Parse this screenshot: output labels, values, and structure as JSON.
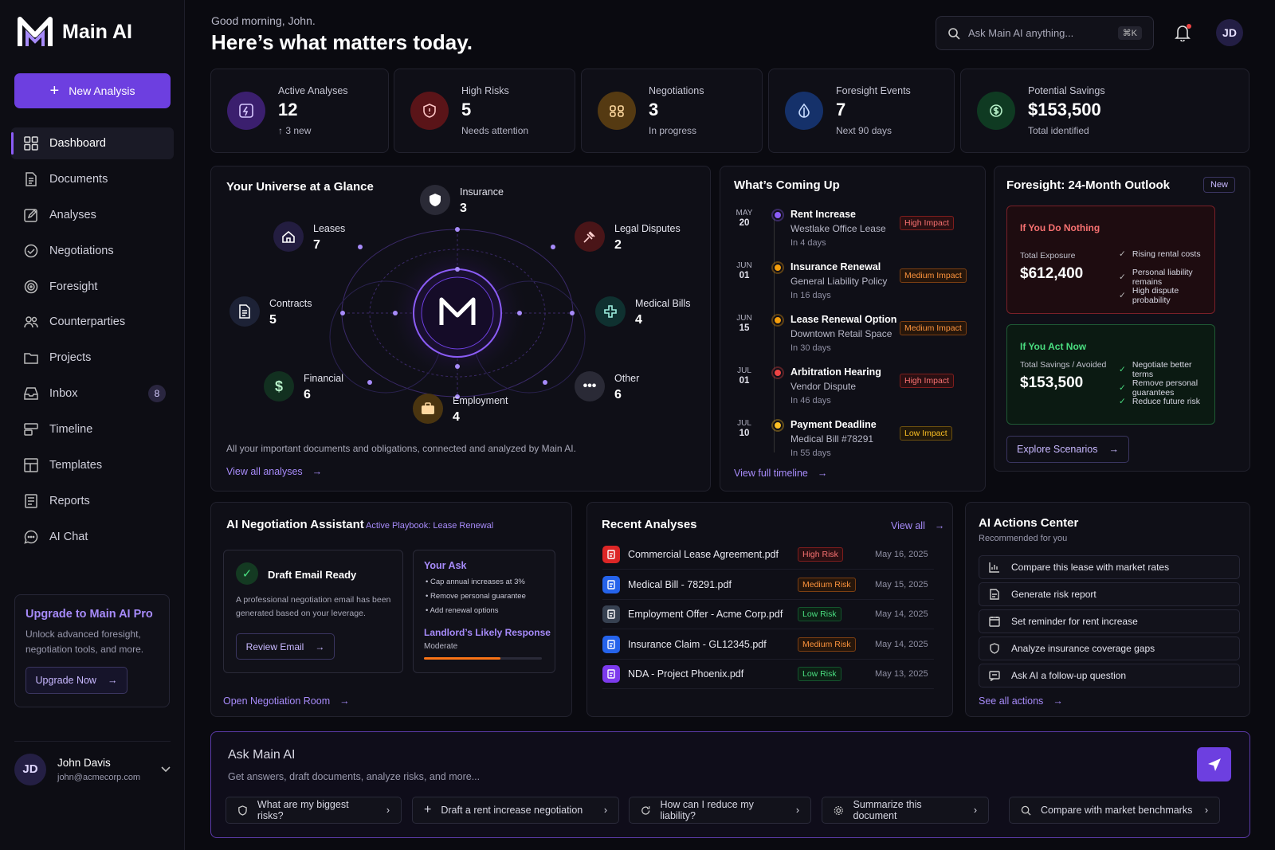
{
  "brand": {
    "name": "Main AI"
  },
  "sidebar": {
    "new_analysis": "New Analysis",
    "items": [
      {
        "label": "Dashboard",
        "icon": "grid-icon"
      },
      {
        "label": "Documents",
        "icon": "document-icon"
      },
      {
        "label": "Analyses",
        "icon": "edit-icon"
      },
      {
        "label": "Negotiations",
        "icon": "handshake-icon"
      },
      {
        "label": "Foresight",
        "icon": "target-icon"
      },
      {
        "label": "Counterparties",
        "icon": "people-icon"
      },
      {
        "label": "Projects",
        "icon": "folder-icon"
      },
      {
        "label": "Inbox",
        "icon": "inbox-icon",
        "badge": "8"
      },
      {
        "label": "Timeline",
        "icon": "timeline-icon"
      },
      {
        "label": "Templates",
        "icon": "templates-icon"
      },
      {
        "label": "Reports",
        "icon": "report-icon"
      },
      {
        "label": "AI Chat",
        "icon": "chat-icon"
      }
    ],
    "upgrade": {
      "title": "Upgrade to Main AI Pro",
      "desc": "Unlock advanced foresight, negotiation tools, and more.",
      "button": "Upgrade Now"
    },
    "user": {
      "initials": "JD",
      "name": "John Davis",
      "email": "john@acmecorp.com"
    }
  },
  "header": {
    "greeting": "Good morning, John.",
    "headline": "Here’s what matters today.",
    "search_placeholder": "Ask Main AI anything...",
    "shortcut": "⌘K",
    "avatar": "JD"
  },
  "kpis": [
    {
      "label": "Active Analyses",
      "value": "12",
      "sub": "↑ 3 new",
      "color": "#8b5cf6"
    },
    {
      "label": "High Risks",
      "value": "5",
      "sub": "Needs attention",
      "color": "#ef4444"
    },
    {
      "label": "Negotiations",
      "value": "3",
      "sub": "In progress",
      "color": "#f59e0b"
    },
    {
      "label": "Foresight Events",
      "value": "7",
      "sub": "Next 90 days",
      "color": "#3b82f6"
    },
    {
      "label": "Potential Savings",
      "value": "$153,500",
      "sub": "Total identified",
      "color": "#22c55e"
    }
  ],
  "universe": {
    "title": "Your Universe at a Glance",
    "nodes": {
      "insurance": {
        "name": "Insurance",
        "count": "3"
      },
      "leases": {
        "name": "Leases",
        "count": "7"
      },
      "legal": {
        "name": "Legal Disputes",
        "count": "2"
      },
      "contracts": {
        "name": "Contracts",
        "count": "5"
      },
      "medical": {
        "name": "Medical Bills",
        "count": "4"
      },
      "financial": {
        "name": "Financial",
        "count": "6"
      },
      "other": {
        "name": "Other",
        "count": "6"
      },
      "employment": {
        "name": "Employment",
        "count": "4"
      }
    },
    "caption": "All your important documents and obligations, connected and analyzed by Main AI.",
    "link": "View all analyses"
  },
  "coming": {
    "title": "What’s Coming Up",
    "items": [
      {
        "mon": "MAY",
        "day": "20",
        "title": "Rent Increase",
        "sub": "Westlake Office Lease",
        "when": "In 4 days",
        "impact": "High Impact",
        "level": "hi",
        "dot": "#8b5cf6"
      },
      {
        "mon": "JUN",
        "day": "01",
        "title": "Insurance Renewal",
        "sub": "General Liability Policy",
        "when": "In 16 days",
        "impact": "Medium Impact",
        "level": "med",
        "dot": "#f59e0b"
      },
      {
        "mon": "JUN",
        "day": "15",
        "title": "Lease Renewal Option",
        "sub": "Downtown Retail Space",
        "when": "In 30 days",
        "impact": "Medium Impact",
        "level": "med",
        "dot": "#f59e0b"
      },
      {
        "mon": "JUL",
        "day": "01",
        "title": "Arbitration Hearing",
        "sub": "Vendor Dispute",
        "when": "In 46 days",
        "impact": "High Impact",
        "level": "hi",
        "dot": "#ef4444"
      },
      {
        "mon": "JUL",
        "day": "10",
        "title": "Payment Deadline",
        "sub": "Medical Bill #78291",
        "when": "In 55 days",
        "impact": "Low Impact",
        "level": "lo",
        "dot": "#fbbf24"
      }
    ],
    "link": "View full timeline"
  },
  "foresight": {
    "title": "Foresight: 24-Month Outlook",
    "badge": "New",
    "nothing": {
      "head": "If You Do Nothing",
      "label": "Total Exposure",
      "value": "$612,400",
      "checks": [
        "Rising rental costs",
        "Personal liability remains",
        "High dispute probability"
      ]
    },
    "act": {
      "head": "If You Act Now",
      "label": "Total Savings / Avoided",
      "value": "$153,500",
      "checks": [
        "Negotiate better terms",
        "Remove personal guarantees",
        "Reduce future risk"
      ]
    },
    "button": "Explore Scenarios"
  },
  "negotiation": {
    "title": "AI Negotiation Assistant",
    "playbook": "Active Playbook: Lease Renewal",
    "draft": {
      "title": "Draft Email Ready",
      "desc": "A professional negotiation email has been generated based on your leverage.",
      "button": "Review Email"
    },
    "ask": {
      "title": "Your Ask",
      "bullets": [
        "Cap annual increases at 3%",
        "Remove personal guarantee",
        "Add renewal options"
      ],
      "response_title": "Landlord’s Likely Response",
      "response_value": "Moderate",
      "response_level": 0.65
    },
    "link": "Open Negotiation Room"
  },
  "recent": {
    "title": "Recent Analyses",
    "view_all": "View all",
    "rows": [
      {
        "name": "Commercial Lease Agreement.pdf",
        "risk": "High Risk",
        "level": "hi",
        "date": "May 16, 2025",
        "icon": "pdf-icon",
        "color": "#dc2626"
      },
      {
        "name": "Medical Bill - 78291.pdf",
        "risk": "Medium Risk",
        "level": "med",
        "date": "May 15, 2025",
        "icon": "medical-icon",
        "color": "#2563eb"
      },
      {
        "name": "Employment Offer - Acme Corp.pdf",
        "risk": "Low Risk",
        "level": "lor",
        "date": "May 14, 2025",
        "icon": "briefcase-icon",
        "color": "#374151"
      },
      {
        "name": "Insurance Claim - GL12345.pdf",
        "risk": "Medium Risk",
        "level": "med",
        "date": "May 14, 2025",
        "icon": "shield-icon",
        "color": "#2563eb"
      },
      {
        "name": "NDA - Project Phoenix.pdf",
        "risk": "Low Risk",
        "level": "lor",
        "date": "May 13, 2025",
        "icon": "document-icon",
        "color": "#7c3aed"
      }
    ]
  },
  "actions": {
    "title": "AI Actions Center",
    "subtitle": "Recommended for you",
    "items": [
      "Compare this lease with market rates",
      "Generate risk report",
      "Set reminder for rent increase",
      "Analyze insurance coverage gaps",
      "Ask AI a follow-up question"
    ],
    "link": "See all actions"
  },
  "ask": {
    "title": "Ask Main AI",
    "placeholder": "Get answers, draft documents, analyze risks, and more...",
    "chips": [
      "What are my biggest risks?",
      "Draft a rent increase negotiation",
      "How can I reduce my liability?",
      "Summarize this document",
      "Compare with market benchmarks"
    ]
  }
}
